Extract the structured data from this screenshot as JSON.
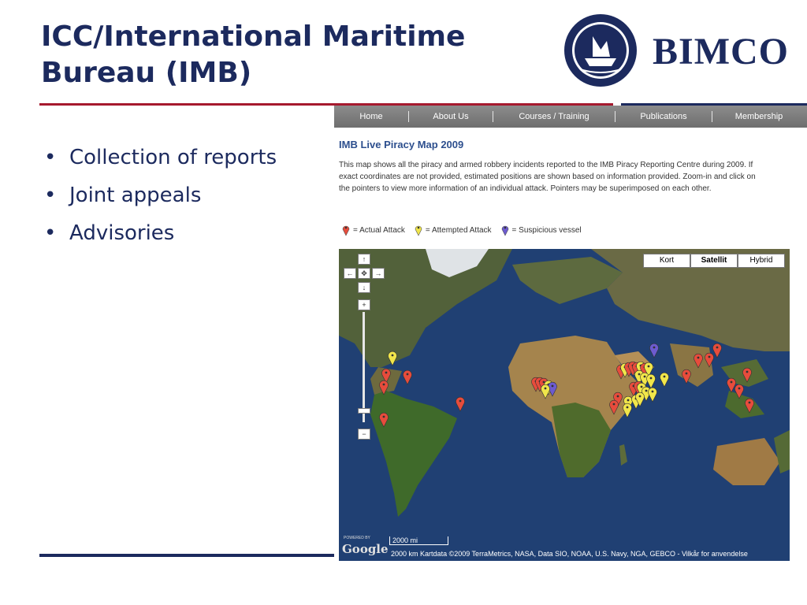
{
  "slide": {
    "title_line1": "ICC/International Maritime",
    "title_line2": "Bureau (IMB)",
    "bullets": [
      "Collection of reports",
      "Joint appeals",
      "Advisories"
    ]
  },
  "logo": {
    "text": "BIMCO"
  },
  "website": {
    "nav": [
      "Home",
      "About Us",
      "Courses / Training",
      "Publications",
      "Membership"
    ],
    "map_title": "IMB Live Piracy Map 2009",
    "description": "This map shows all the piracy and armed robbery incidents reported to the IMB Piracy Reporting Centre during 2009. If exact coordinates are not provided, estimated positions are shown based on information provided. Zoom-in and click on the pointers to view more information of an individual attack. Pointers may be superimposed on each other.",
    "legend": [
      {
        "label": "= Actual Attack",
        "color": "#e74c3c"
      },
      {
        "label": "= Attempted Attack",
        "color": "#f1e64a"
      },
      {
        "label": "= Suspicious vessel",
        "color": "#6d5bd0"
      }
    ],
    "map_types": [
      "Kort",
      "Satellit",
      "Hybrid"
    ],
    "active_map_type": "Satellit",
    "scale_top": "2000 mi",
    "scale_bottom": "2000 km",
    "attribution": "Kartdata ©2009 TerraMetrics, NASA, Data SIO, NOAA, U.S. Navy, NGA, GEBCO - Vilkår for anvendelse",
    "google_logo": "Google",
    "powered_by": "POWERED BY"
  },
  "colors": {
    "navy": "#1c2a5e",
    "red_rule": "#a6192e",
    "actual": "#e74c3c",
    "attempted": "#f1e64a",
    "suspicious": "#6d5bd0"
  }
}
